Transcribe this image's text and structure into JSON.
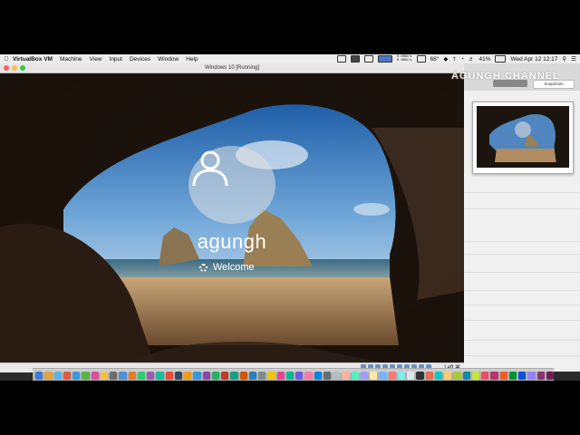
{
  "menubar": {
    "app": "VirtualBox VM",
    "items": [
      "Machine",
      "View",
      "Input",
      "Devices",
      "Window",
      "Help"
    ],
    "net_up": "0.0KB/s",
    "net_down": "0.0KB/s",
    "temp": "68°",
    "battery": "41%",
    "datetime": "Wed Apr 12  12:17"
  },
  "window": {
    "title": "Windows 10 [Running]"
  },
  "guest": {
    "username": "agungh",
    "welcome": "Welcome"
  },
  "statusbar": {
    "hostkey": "Left ⌘"
  },
  "side": {
    "watermark": "AGUNGH CHANNEL",
    "snapshots": "Snapshots"
  },
  "dock": {
    "colors": [
      "#3d79d8",
      "#e5a33a",
      "#5bb5e5",
      "#e05a45",
      "#3a9ad9",
      "#59b34f",
      "#d94f9c",
      "#f3c33f",
      "#6c6c6c",
      "#4e8fd6",
      "#e67e22",
      "#2ecc71",
      "#9b59b6",
      "#1abc9c",
      "#e74c3c",
      "#34495e",
      "#f39c12",
      "#3498db",
      "#8e44ad",
      "#27ae60",
      "#c0392b",
      "#16a085",
      "#d35400",
      "#2980b9",
      "#7f8c8d",
      "#f1c40f",
      "#e84393",
      "#00b894",
      "#6c5ce7",
      "#fd79a8",
      "#0984e3",
      "#636e72",
      "#b2bec3",
      "#fab1a0",
      "#55efc4",
      "#a29bfe",
      "#ffeaa7",
      "#74b9ff",
      "#ff7675",
      "#81ecec",
      "#dfe6e9",
      "#2d3436",
      "#e17055",
      "#00cec9",
      "#fdcb6e",
      "#a3cb38",
      "#1289a7",
      "#c4e538",
      "#ed4c67",
      "#b53471",
      "#ee5a24",
      "#009432",
      "#0652dd",
      "#9980fa",
      "#833471",
      "#6f1e51"
    ]
  }
}
